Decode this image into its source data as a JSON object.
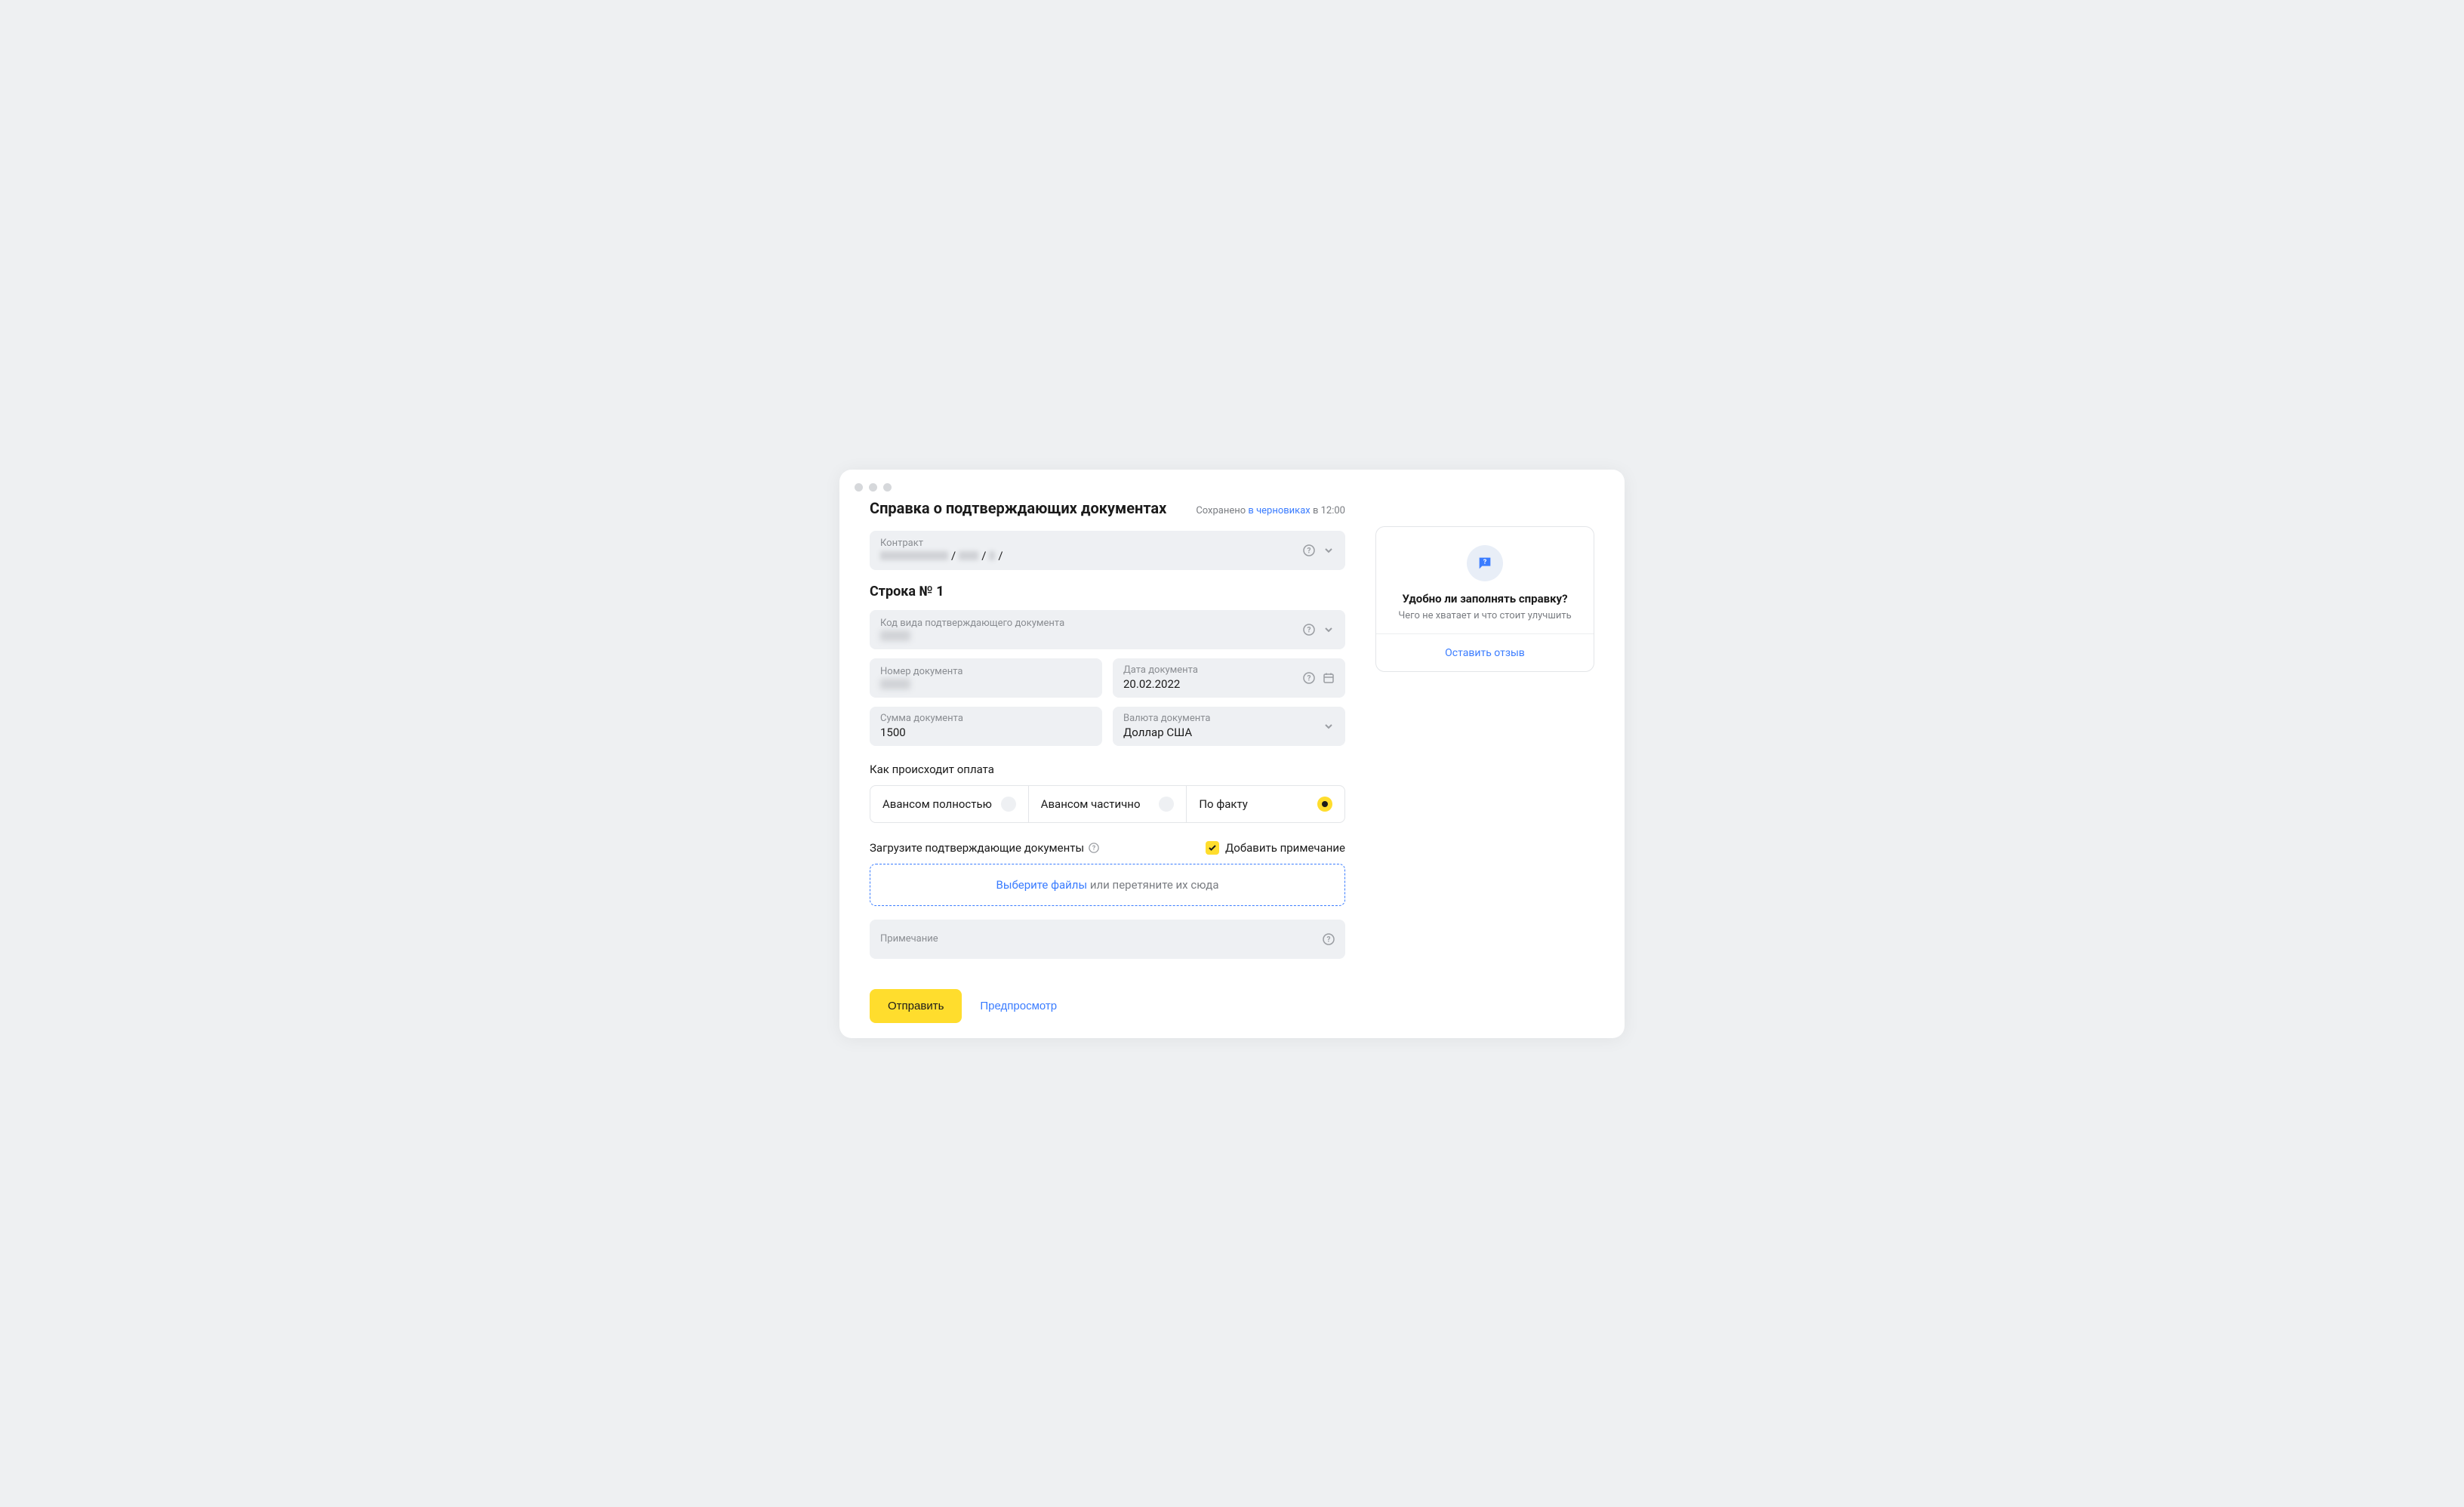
{
  "page_title": "Справка о подтверждающих документах",
  "saved": {
    "prefix": "Сохранено ",
    "link": "в черновиках",
    "suffix": " в 12:00"
  },
  "contract": {
    "label": "Контракт"
  },
  "row_title": "Строка № 1",
  "doc_code": {
    "label": "Код вида подтверждающего документа"
  },
  "doc_number": {
    "label": "Номер документа"
  },
  "doc_date": {
    "label": "Дата документа",
    "value": "20.02.2022"
  },
  "doc_sum": {
    "label": "Сумма документа",
    "value": "1500"
  },
  "doc_currency": {
    "label": "Валюта документа",
    "value": "Доллар США"
  },
  "payment_label": "Как происходит оплата",
  "payment_options": {
    "advance_full": "Авансом полностью",
    "advance_partial": "Авансом частично",
    "by_fact": "По факту"
  },
  "payment_selected": "by_fact",
  "upload": {
    "label": "Загрузите подтверждающие документы",
    "add_note_label": "Добавить примечание",
    "dropzone_action": "Выберите файлы",
    "dropzone_rest": " или перетяните их сюда"
  },
  "note": {
    "label": "Примечание"
  },
  "actions": {
    "submit": "Отправить",
    "preview": "Предпросмотр"
  },
  "feedback": {
    "title": "Удобно ли заполнять справку?",
    "subtitle": "Чего не хватает и что стоит улучшить",
    "link": "Оставить отзыв"
  }
}
